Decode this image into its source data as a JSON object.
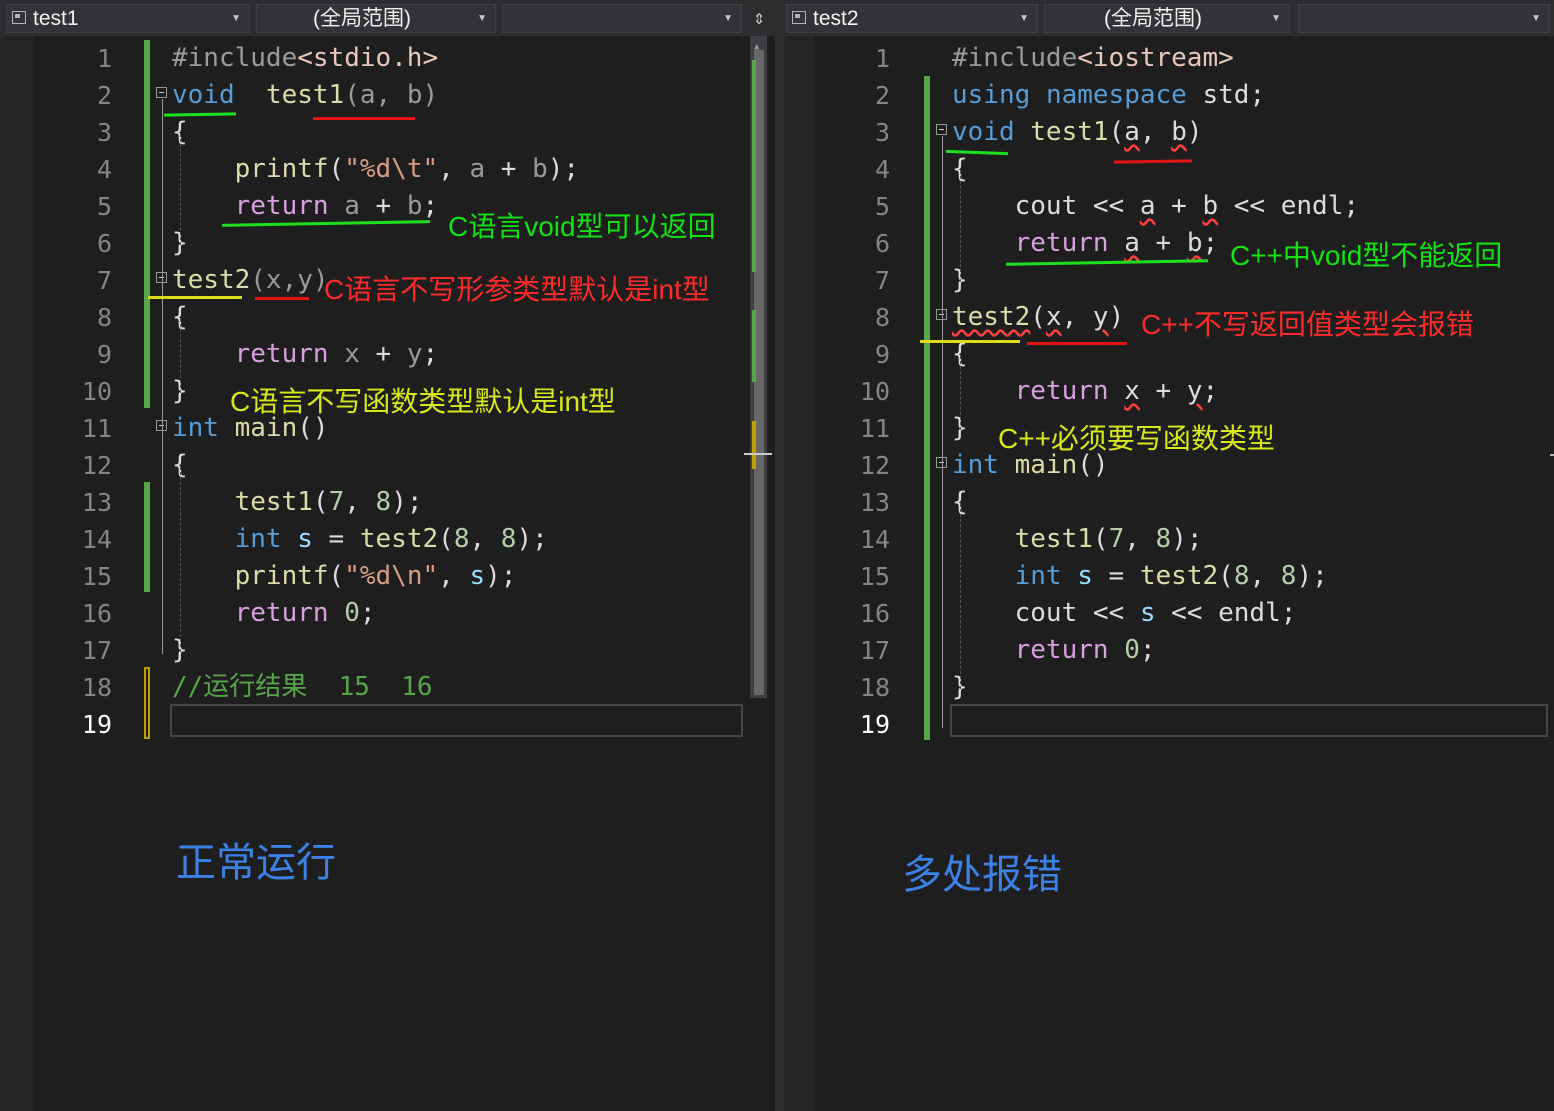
{
  "left": {
    "file_dropdown": "test1",
    "scope_dropdown": "(全局范围)",
    "member_dropdown": "",
    "code": [
      {
        "n": "1",
        "tokens": [
          [
            "pre",
            "#include"
          ],
          [
            "hdr",
            "<stdio.h>"
          ]
        ]
      },
      {
        "n": "2",
        "tokens": [
          [
            "kw",
            "void"
          ],
          [
            "",
            "  "
          ],
          [
            "fn",
            "test1"
          ],
          [
            "par",
            "(a, b)"
          ]
        ]
      },
      {
        "n": "3",
        "tokens": [
          [
            "",
            "{"
          ]
        ]
      },
      {
        "n": "4",
        "tokens": [
          [
            "",
            "    "
          ],
          [
            "fn",
            "printf"
          ],
          [
            "",
            "("
          ],
          [
            "str",
            "\"%d\\t\""
          ],
          [
            "",
            ", "
          ],
          [
            "par",
            "a"
          ],
          [
            "",
            " + "
          ],
          [
            "par",
            "b"
          ],
          [
            "",
            ");"
          ]
        ]
      },
      {
        "n": "5",
        "tokens": [
          [
            "",
            "    "
          ],
          [
            "ctl",
            "return"
          ],
          [
            "",
            " "
          ],
          [
            "par",
            "a"
          ],
          [
            "",
            " + "
          ],
          [
            "par",
            "b"
          ],
          [
            "",
            ";"
          ]
        ]
      },
      {
        "n": "6",
        "tokens": [
          [
            "",
            "}"
          ]
        ]
      },
      {
        "n": "7",
        "tokens": [
          [
            "fn",
            "test2"
          ],
          [
            "par",
            "(x,y)"
          ]
        ]
      },
      {
        "n": "8",
        "tokens": [
          [
            "",
            "{"
          ]
        ]
      },
      {
        "n": "9",
        "tokens": [
          [
            "",
            "    "
          ],
          [
            "ctl",
            "return"
          ],
          [
            "",
            " "
          ],
          [
            "par",
            "x"
          ],
          [
            "",
            " + "
          ],
          [
            "par",
            "y"
          ],
          [
            "",
            ";"
          ]
        ]
      },
      {
        "n": "10",
        "tokens": [
          [
            "",
            "}"
          ]
        ]
      },
      {
        "n": "11",
        "tokens": [
          [
            "kw",
            "int"
          ],
          [
            "",
            " "
          ],
          [
            "fn",
            "main"
          ],
          [
            "",
            "()"
          ]
        ]
      },
      {
        "n": "12",
        "tokens": [
          [
            "",
            "{"
          ]
        ]
      },
      {
        "n": "13",
        "tokens": [
          [
            "",
            "    "
          ],
          [
            "fn",
            "test1"
          ],
          [
            "",
            "("
          ],
          [
            "num",
            "7"
          ],
          [
            "",
            ", "
          ],
          [
            "num",
            "8"
          ],
          [
            "",
            ");"
          ]
        ]
      },
      {
        "n": "14",
        "tokens": [
          [
            "",
            "    "
          ],
          [
            "kw",
            "int"
          ],
          [
            "",
            " "
          ],
          [
            "var",
            "s"
          ],
          [
            "",
            " = "
          ],
          [
            "fn",
            "test2"
          ],
          [
            "",
            "("
          ],
          [
            "num",
            "8"
          ],
          [
            "",
            ", "
          ],
          [
            "num",
            "8"
          ],
          [
            "",
            ");"
          ]
        ]
      },
      {
        "n": "15",
        "tokens": [
          [
            "",
            "    "
          ],
          [
            "fn",
            "printf"
          ],
          [
            "",
            "("
          ],
          [
            "str",
            "\"%d\\n\""
          ],
          [
            "",
            ", "
          ],
          [
            "var",
            "s"
          ],
          [
            "",
            ");"
          ]
        ]
      },
      {
        "n": "16",
        "tokens": [
          [
            "",
            "    "
          ],
          [
            "ctl",
            "return"
          ],
          [
            "",
            " "
          ],
          [
            "num",
            "0"
          ],
          [
            "",
            ";"
          ]
        ]
      },
      {
        "n": "17",
        "tokens": [
          [
            "",
            "}"
          ]
        ]
      },
      {
        "n": "18",
        "tokens": [
          [
            "cmt",
            "//运行结果  15  16"
          ]
        ]
      },
      {
        "n": "19",
        "tokens": []
      }
    ],
    "annotations": {
      "void_return": "C语言void型可以返回",
      "no_param_type": "C语言不写形参类型默认是int型",
      "no_func_type": "C语言不写函数类型默认是int型",
      "result": "正常运行"
    }
  },
  "right": {
    "file_dropdown": "test2",
    "scope_dropdown": "(全局范围)",
    "member_dropdown": "",
    "code": [
      {
        "n": "1",
        "tokens": [
          [
            "pre",
            "#include"
          ],
          [
            "hdr",
            "<iostream>"
          ]
        ]
      },
      {
        "n": "2",
        "tokens": [
          [
            "kw",
            "using"
          ],
          [
            "",
            " "
          ],
          [
            "kw",
            "namespace"
          ],
          [
            "",
            " std;"
          ]
        ]
      },
      {
        "n": "3",
        "tokens": [
          [
            "kw",
            "void"
          ],
          [
            "",
            " "
          ],
          [
            "fn",
            "test1"
          ],
          [
            "",
            "("
          ],
          [
            "w",
            "a"
          ],
          [
            "",
            ", "
          ],
          [
            "w",
            "b"
          ],
          [
            "",
            ")"
          ]
        ]
      },
      {
        "n": "4",
        "tokens": [
          [
            "",
            "{"
          ]
        ]
      },
      {
        "n": "5",
        "tokens": [
          [
            "",
            "    cout << "
          ],
          [
            "w",
            "a"
          ],
          [
            "",
            " + "
          ],
          [
            "w",
            "b"
          ],
          [
            "",
            " << endl;"
          ]
        ]
      },
      {
        "n": "6",
        "tokens": [
          [
            "",
            "    "
          ],
          [
            "ctl",
            "return"
          ],
          [
            "",
            " "
          ],
          [
            "w",
            "a"
          ],
          [
            "",
            " + "
          ],
          [
            "w",
            "b"
          ],
          [
            "",
            ";"
          ]
        ]
      },
      {
        "n": "7",
        "tokens": [
          [
            "",
            "}"
          ]
        ]
      },
      {
        "n": "8",
        "tokens": [
          [
            "fnw",
            "test2"
          ],
          [
            "",
            "("
          ],
          [
            "w",
            "x"
          ],
          [
            "",
            ", "
          ],
          [
            "w",
            "y"
          ],
          [
            "",
            ")"
          ]
        ]
      },
      {
        "n": "9",
        "tokens": [
          [
            "",
            "{"
          ]
        ]
      },
      {
        "n": "10",
        "tokens": [
          [
            "",
            "    "
          ],
          [
            "ctl",
            "return"
          ],
          [
            "",
            " "
          ],
          [
            "w",
            "x"
          ],
          [
            "",
            " + "
          ],
          [
            "w",
            "y"
          ],
          [
            "",
            ";"
          ]
        ]
      },
      {
        "n": "11",
        "tokens": [
          [
            "",
            "}"
          ]
        ]
      },
      {
        "n": "12",
        "tokens": [
          [
            "kw",
            "int"
          ],
          [
            "",
            " "
          ],
          [
            "fn",
            "main"
          ],
          [
            "",
            "()"
          ]
        ]
      },
      {
        "n": "13",
        "tokens": [
          [
            "",
            "{"
          ]
        ]
      },
      {
        "n": "14",
        "tokens": [
          [
            "",
            "    "
          ],
          [
            "fn",
            "test1"
          ],
          [
            "",
            "("
          ],
          [
            "num",
            "7"
          ],
          [
            "",
            ", "
          ],
          [
            "num",
            "8"
          ],
          [
            "",
            ");"
          ]
        ]
      },
      {
        "n": "15",
        "tokens": [
          [
            "",
            "    "
          ],
          [
            "kw",
            "int"
          ],
          [
            "",
            " "
          ],
          [
            "var",
            "s"
          ],
          [
            "",
            " = "
          ],
          [
            "fn",
            "test2"
          ],
          [
            "",
            "("
          ],
          [
            "num",
            "8"
          ],
          [
            "",
            ", "
          ],
          [
            "num",
            "8"
          ],
          [
            "",
            ");"
          ]
        ]
      },
      {
        "n": "16",
        "tokens": [
          [
            "",
            "    cout << "
          ],
          [
            "var",
            "s"
          ],
          [
            "",
            " << endl;"
          ]
        ]
      },
      {
        "n": "17",
        "tokens": [
          [
            "",
            "    "
          ],
          [
            "ctl",
            "return"
          ],
          [
            "",
            " "
          ],
          [
            "num",
            "0"
          ],
          [
            "",
            ";"
          ]
        ]
      },
      {
        "n": "18",
        "tokens": [
          [
            "",
            "}"
          ]
        ]
      },
      {
        "n": "19",
        "tokens": []
      }
    ],
    "annotations": {
      "void_return": "C++中void型不能返回",
      "no_return_type": "C++不写返回值类型会报错",
      "must_func_type": "C++必须要写函数类型",
      "result": "多处报错"
    }
  }
}
